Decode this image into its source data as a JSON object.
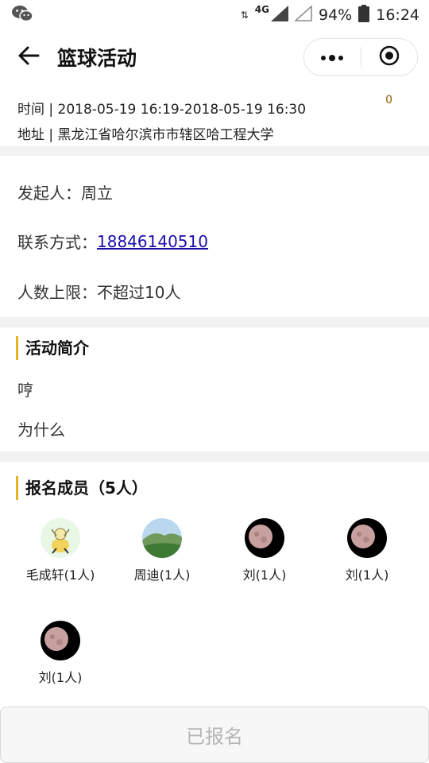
{
  "status_bar": {
    "network": "4G",
    "battery": "94%",
    "time": "16:24"
  },
  "nav": {
    "title": "篮球活动"
  },
  "header": {
    "time_label": "时间",
    "time_value": "2018-05-19 16:19-2018-05-19 16:30",
    "address_label": "地址",
    "address_value": "黑龙江省哈尔滨市市辖区哈工程大学",
    "badge": "0"
  },
  "details": {
    "organizer_label": "发起人：",
    "organizer": "周立",
    "contact_label": "联系方式：",
    "contact": "18846140510",
    "limit_label": "人数上限：",
    "limit": "不超过10人"
  },
  "intro": {
    "title": "活动简介",
    "lines": [
      "哼",
      "为什么"
    ]
  },
  "members": {
    "title": "报名成员（5人）",
    "items": [
      {
        "name": "毛成轩(1人)",
        "avatar": "cartoon-avatar"
      },
      {
        "name": "周迪(1人)",
        "avatar": "landscape-avatar"
      },
      {
        "name": "刘(1人)",
        "avatar": "moon-avatar"
      },
      {
        "name": "刘(1人)",
        "avatar": "moon-avatar"
      },
      {
        "name": "刘(1人)",
        "avatar": "moon-avatar"
      }
    ]
  },
  "action": {
    "label": "已报名"
  },
  "colors": {
    "accent_bar": "#e6b422",
    "link": "#1a0dab",
    "disabled_text": "#b5b5b5"
  }
}
